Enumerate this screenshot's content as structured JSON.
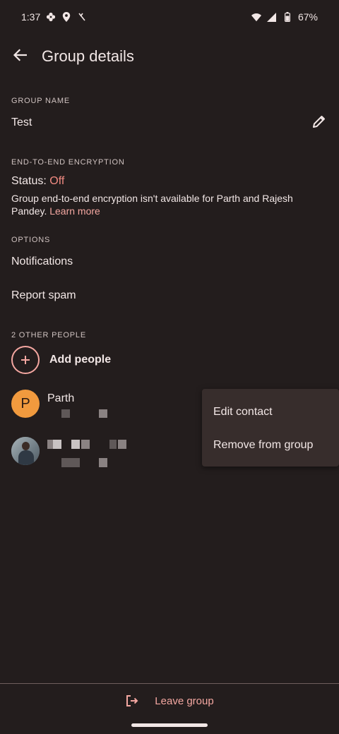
{
  "status_bar": {
    "time": "1:37",
    "battery": "67%",
    "left_icons": [
      "pinwheel-icon",
      "location-pin-icon",
      "no-signal-icon"
    ],
    "right_icons": [
      "wifi-icon",
      "cell-signal-icon",
      "battery-icon"
    ]
  },
  "app_bar": {
    "title": "Group details",
    "back_icon": "arrow-back-icon"
  },
  "group_name": {
    "label": "GROUP NAME",
    "value": "Test",
    "edit_icon": "pencil-icon"
  },
  "encryption": {
    "label": "END-TO-END ENCRYPTION",
    "status_prefix": "Status:",
    "status_value": "Off",
    "description": "Group end-to-end encryption isn't available for Parth and Rajesh Pandey.",
    "learn_more": "Learn more",
    "status_color": "#f28b82",
    "link_color": "#f4a7a1"
  },
  "options": {
    "label": "OPTIONS",
    "items": [
      "Notifications",
      "Report spam"
    ]
  },
  "people": {
    "label": "2 OTHER PEOPLE",
    "add_label": "Add people",
    "members": [
      {
        "initial": "P",
        "name": "Parth"
      },
      {
        "initial": "",
        "name": ""
      }
    ]
  },
  "context_menu": {
    "items": [
      "Edit contact",
      "Remove from group"
    ]
  },
  "footer": {
    "leave_label": "Leave group",
    "leave_icon": "exit-icon"
  },
  "colors": {
    "background": "#231d1d",
    "accent": "#f4a7a1",
    "avatar_orange": "#f19a3e",
    "menu_bg": "#372d2c"
  }
}
